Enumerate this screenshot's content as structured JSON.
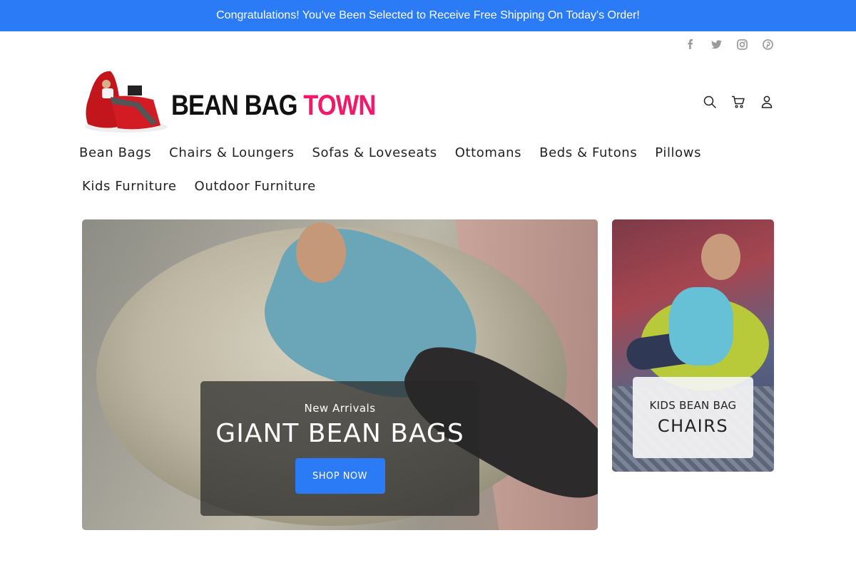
{
  "announcement": {
    "text": "Congratulations! You've Been Selected to Receive Free Shipping On Today's Order!"
  },
  "social": [
    "facebook-icon",
    "twitter-icon",
    "instagram-icon",
    "pinterest-icon"
  ],
  "logo": {
    "text_black": "BEAN BAG ",
    "text_pink": "TOWN"
  },
  "header_icons": [
    "search-icon",
    "cart-icon",
    "account-icon"
  ],
  "nav": {
    "row1": [
      "Bean Bags",
      "Chairs & Loungers",
      "Sofas & Loveseats",
      "Ottomans",
      "Beds & Futons",
      "Pillows"
    ],
    "row2": [
      "Kids Furniture",
      "Outdoor Furniture"
    ]
  },
  "hero": {
    "eyebrow": "New Arrivals",
    "headline": "GIANT BEAN BAGS",
    "cta": "SHOP NOW"
  },
  "side_banner": {
    "line1": "KIDS BEAN BAG",
    "line2": "CHAIRS"
  },
  "colors": {
    "accent": "#2b7bf7",
    "brand_pink": "#f5176a"
  }
}
